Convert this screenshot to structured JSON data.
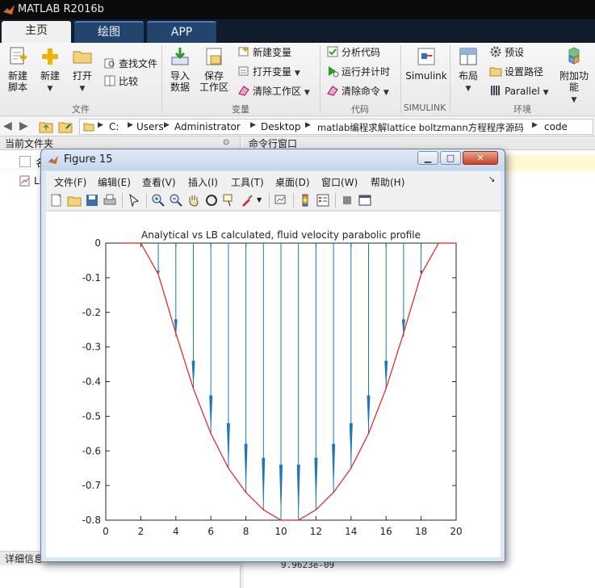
{
  "app": {
    "title": "MATLAB R2016b",
    "tabs": [
      "主页",
      "绘图",
      "APP"
    ]
  },
  "ribbon": {
    "file_group": {
      "new_script": "新建\n脚本",
      "new": "新建",
      "open": "打开",
      "find_files": "查找文件",
      "compare": "比较",
      "label": "文件"
    },
    "variable_group": {
      "import_data": "导入\n数据",
      "save_workspace": "保存\n工作区",
      "new_variable": "新建变量",
      "open_variable": "打开变量",
      "clear_workspace": "清除工作区",
      "label": "变量"
    },
    "code_group": {
      "analyze_code": "分析代码",
      "run_and_time": "运行并计时",
      "clear_commands": "清除命令",
      "label": "代码"
    },
    "simulink_group": {
      "simulink": "Simulink",
      "label": "SIMULINK"
    },
    "environment_group": {
      "layout": "布局",
      "preferences": "预设",
      "set_path": "设置路径",
      "parallel": "Parallel",
      "addons": "附加功能",
      "label": "环境"
    }
  },
  "address_bar": {
    "crumbs": [
      "C:",
      "Users",
      "Administrator",
      "Desktop",
      "matlab编程求解lattice boltzmann方程程序源码",
      "code"
    ]
  },
  "left_panel": {
    "title": "当前文件夹",
    "details_label": "详细信息",
    "row1_prefix": "名",
    "row2_prefix": "LE"
  },
  "command_window": {
    "title": "命令行窗口",
    "output_line": "9.9623e-09"
  },
  "figure": {
    "title": "Figure 15",
    "menus": [
      "文件(F)",
      "编辑(E)",
      "查看(V)",
      "插入(I)",
      "工具(T)",
      "桌面(D)",
      "窗口(W)",
      "帮助(H)"
    ]
  },
  "colors": {
    "analytical_line": "#e02020",
    "lb_quiver": "#1f77b4",
    "window_dark": "#0b0b0b",
    "tab_blue": "#23446d"
  },
  "chart_data": {
    "type": "line",
    "title": "Analytical vs LB calculated, fluid velocity parabolic profile",
    "xlabel": "",
    "ylabel": "",
    "xlim": [
      0,
      20
    ],
    "ylim": [
      -0.8,
      0
    ],
    "xticks": [
      0,
      2,
      4,
      6,
      8,
      10,
      12,
      14,
      16,
      18,
      20
    ],
    "yticks": [
      0,
      -0.1,
      -0.2,
      -0.3,
      -0.4,
      -0.5,
      -0.6,
      -0.7,
      -0.8
    ],
    "grid": false,
    "series": [
      {
        "style": "analytical line",
        "x": [
          1,
          2,
          3,
          4,
          5,
          6,
          7,
          8,
          9,
          10,
          11,
          12,
          13,
          14,
          15,
          16,
          17,
          18,
          19,
          20
        ],
        "values": [
          0,
          0,
          -0.09,
          -0.26,
          -0.42,
          -0.55,
          -0.65,
          -0.72,
          -0.77,
          -0.8,
          -0.8,
          -0.77,
          -0.72,
          -0.65,
          -0.55,
          -0.42,
          -0.26,
          -0.09,
          0,
          0
        ]
      },
      {
        "style": "LB quiver (stem from y=0)",
        "x": [
          3,
          4,
          5,
          6,
          7,
          8,
          9,
          10,
          11,
          12,
          13,
          14,
          15,
          16,
          17,
          18
        ],
        "values": [
          -0.09,
          -0.27,
          -0.42,
          -0.55,
          -0.65,
          -0.72,
          -0.77,
          -0.8,
          -0.8,
          -0.77,
          -0.72,
          -0.65,
          -0.55,
          -0.42,
          -0.27,
          -0.09
        ],
        "arrow_start": [
          -0.08,
          -0.22,
          -0.34,
          -0.44,
          -0.52,
          -0.58,
          -0.62,
          -0.64,
          -0.64,
          -0.62,
          -0.58,
          -0.52,
          -0.44,
          -0.34,
          -0.22,
          -0.08
        ]
      }
    ]
  }
}
